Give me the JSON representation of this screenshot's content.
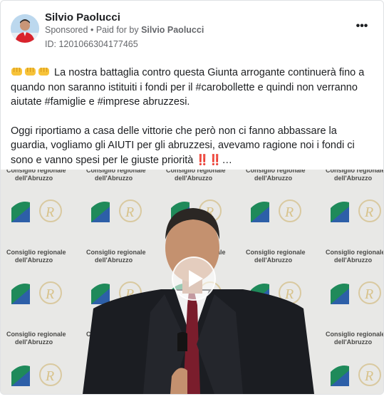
{
  "post": {
    "author": "Silvio Paolucci",
    "sponsored": "Sponsored",
    "separator": "•",
    "paid_for_prefix": "Paid for by",
    "paid_for_name": "Silvio Paolucci",
    "ad_id": "ID: 1201066304177465",
    "more_label": "•••",
    "paragraph_1_emojis": [
      "fist-icon",
      "fist-icon",
      "fist-icon"
    ],
    "paragraph_1": "La nostra battaglia contro questa Giunta arrogante continuerà fino a quando non saranno istituiti i fondi per il #carobollette e quindi non verranno aiutate #famiglie e #imprese abruzzesi.",
    "paragraph_2": "Oggi riportiamo a casa delle vittorie che però non ci fanno abbassare la guardia, vogliamo gli AIUTI per gli abruzzesi, avevamo ragione noi i fondi ci sono e vanno spesi per le giuste priorità ‼️‼️…"
  },
  "video": {
    "backdrop_label": "Consiglio regionale dell'Abruzzo",
    "backdrop_line_1": "Consiglio regionale",
    "backdrop_line_2": "dell'Abruzzo",
    "play_icon": "play-icon"
  },
  "colors": {
    "text": "#1c1e21",
    "secondary": "#65676b",
    "border": "#dfe1e4",
    "emoji": "#f7c33a"
  }
}
